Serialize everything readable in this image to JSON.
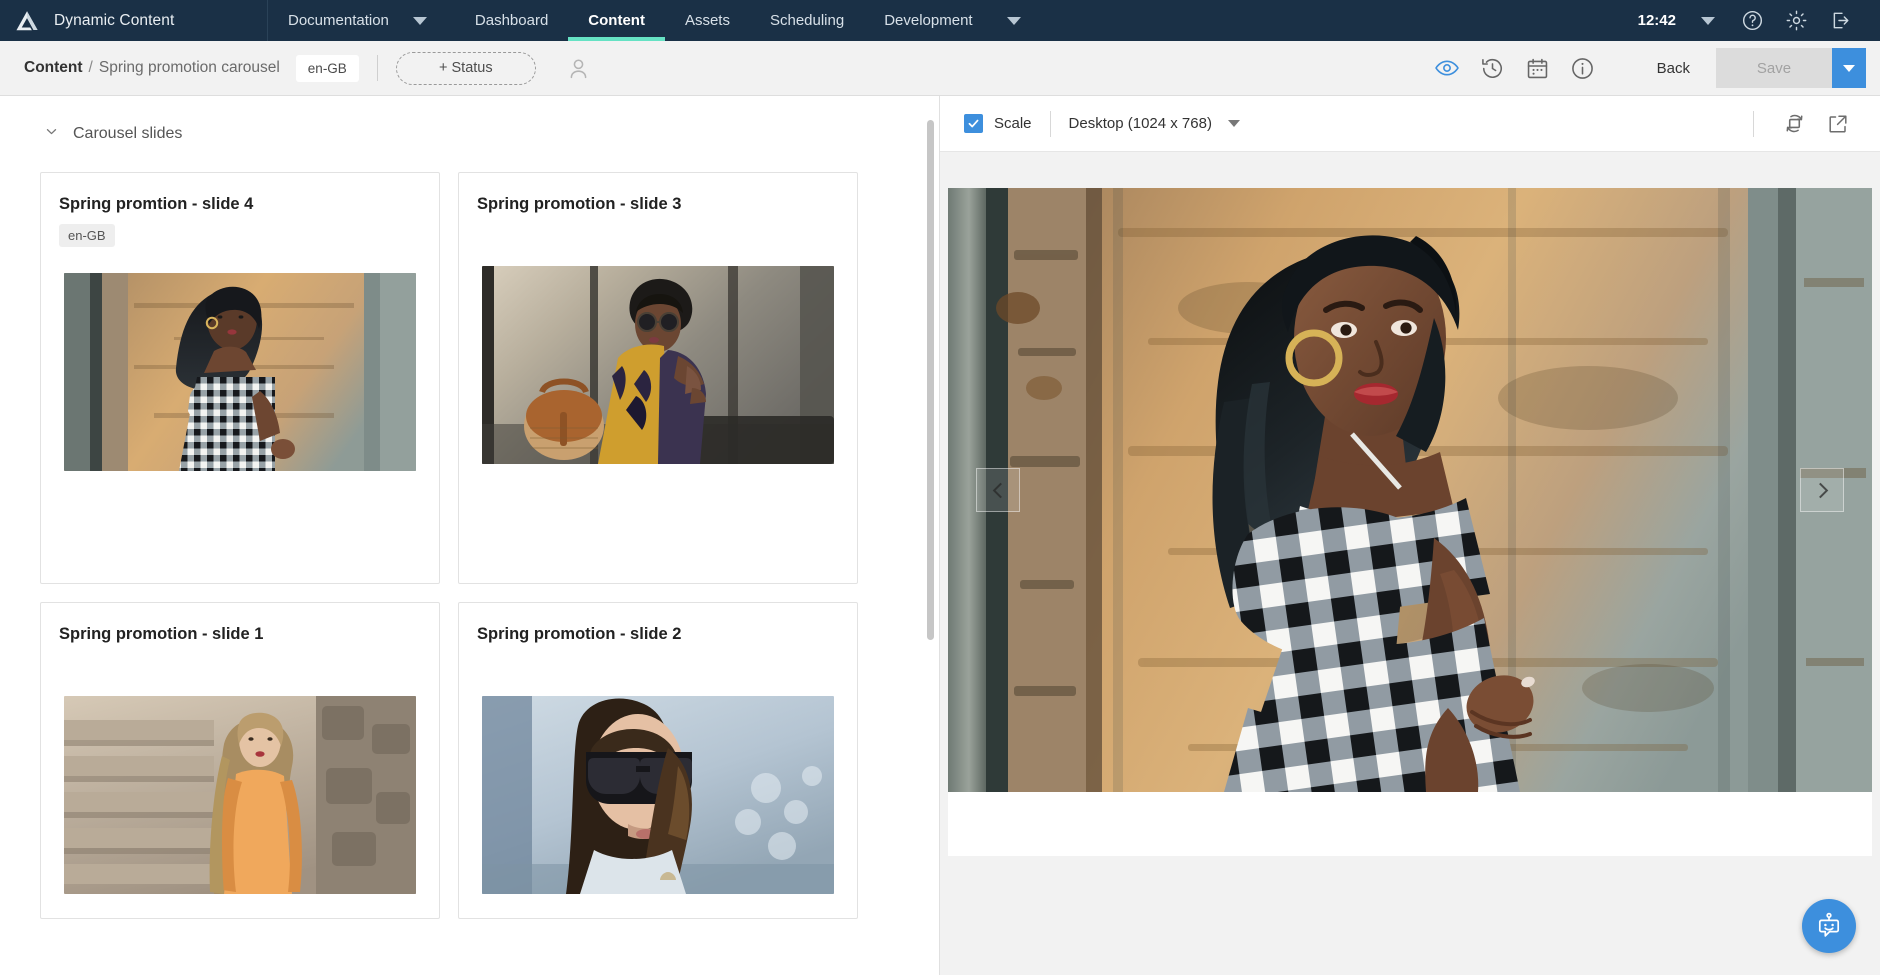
{
  "topnav": {
    "logo_icon": "amplience-logo-icon",
    "brand": "Dynamic Content",
    "items": [
      {
        "label": "Documentation",
        "icon": "chevron-down-icon",
        "active": false
      },
      {
        "label": "Dashboard",
        "active": false
      },
      {
        "label": "Content",
        "active": true
      },
      {
        "label": "Assets",
        "active": false
      },
      {
        "label": "Scheduling",
        "active": false
      },
      {
        "label": "Development",
        "active": false
      }
    ],
    "dev_caret_icon": "chevron-down-icon",
    "clock": "12:42",
    "account_caret_icon": "chevron-down-icon",
    "help_icon": "help-circle-icon",
    "settings_icon": "gear-icon",
    "logout_icon": "logout-icon",
    "active_accent": "#66e2c4",
    "background": "#1a3046"
  },
  "breadcrumb": {
    "root": "Content",
    "separator": "/",
    "leaf": "Spring promotion carousel",
    "locale": "en-GB",
    "status_button": "+ Status",
    "avatar_icon": "user-avatar-icon",
    "actions": [
      {
        "icon": "eye-icon",
        "name": "preview-toggle",
        "active": true
      },
      {
        "icon": "history-icon",
        "name": "version-history"
      },
      {
        "icon": "calendar-icon",
        "name": "schedule"
      },
      {
        "icon": "info-icon",
        "name": "details"
      }
    ],
    "back_label": "Back",
    "save_label": "Save",
    "save_disabled": true,
    "save_caret_icon": "chevron-down-icon",
    "save_caret_color": "#3d8fdd"
  },
  "editor": {
    "section": {
      "collapse_icon": "chevron-down-icon",
      "title": "Carousel slides"
    },
    "slides": [
      {
        "title": "Spring promtion - slide 4",
        "locale": "en-GB",
        "image": "woman-gingham-dress-rust-wall"
      },
      {
        "title": "Spring promotion - slide 3",
        "locale": null,
        "image": "woman-sunglasses-basket-bag"
      },
      {
        "title": "Spring promotion - slide 1",
        "locale": null,
        "image": "woman-orange-top-stone-steps"
      },
      {
        "title": "Spring promotion - slide 2",
        "locale": null,
        "image": "woman-cat-eye-sunglasses-harbour"
      }
    ]
  },
  "preview": {
    "scale_label": "Scale",
    "scale_checked": true,
    "checkbox_color": "#3d8fdd",
    "check_icon": "check-icon",
    "device": "Desktop (1024 x 768)",
    "device_caret_icon": "chevron-down-icon",
    "rotate_icon": "rotate-device-icon",
    "popout_icon": "open-external-icon",
    "hero_image": "woman-gingham-dress-rust-wall",
    "prev_arrow_icon": "chevron-left-icon",
    "next_arrow_icon": "chevron-right-icon"
  },
  "chat": {
    "icon": "chatbot-icon",
    "color": "#3d8fdd"
  }
}
